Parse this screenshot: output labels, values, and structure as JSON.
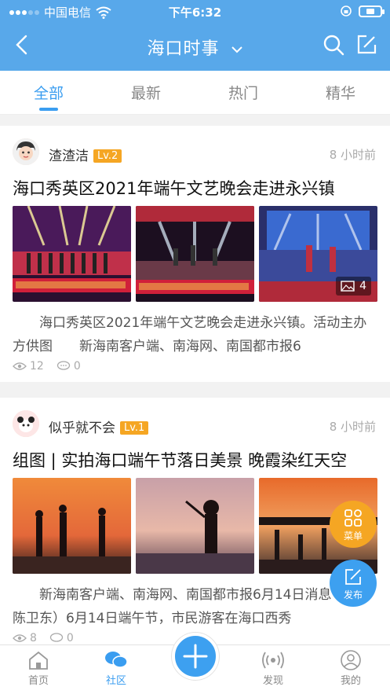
{
  "status": {
    "carrier": "中国电信",
    "time": "下午6:32"
  },
  "nav": {
    "title": "海口时事"
  },
  "tabs": [
    "全部",
    "最新",
    "热门",
    "精华"
  ],
  "posts": [
    {
      "user": "渣渣洁",
      "level": "Lv.2",
      "time": "8 小时前",
      "title": "海口秀英区2021年端午文艺晚会走进永兴镇",
      "image_count": "4",
      "excerpt": "海口秀英区2021年端午文艺晚会走进永兴镇。活动主办方供图　　新海南客户端、南海网、南国都市报6",
      "views": "12",
      "comments": "0"
    },
    {
      "user": "似乎就不会",
      "level": "Lv.1",
      "time": "8 小时前",
      "title": "组图 | 实拍海口端午节落日美景 晚霞染红天空",
      "image_count": "4",
      "excerpt": "新海南客户端、南海网、南国都市报6月14日消息（记者 陈卫东）6月14日端午节，市民游客在海口西秀",
      "views": "8",
      "comments": "0"
    }
  ],
  "fabs": {
    "menu": "菜单",
    "post": "发布"
  },
  "bottom_nav": [
    "首页",
    "社区",
    "发现",
    "我的"
  ],
  "colors": {
    "primary": "#58a8ea",
    "accent": "#3a9df0",
    "level_badge": "#f5a623"
  }
}
